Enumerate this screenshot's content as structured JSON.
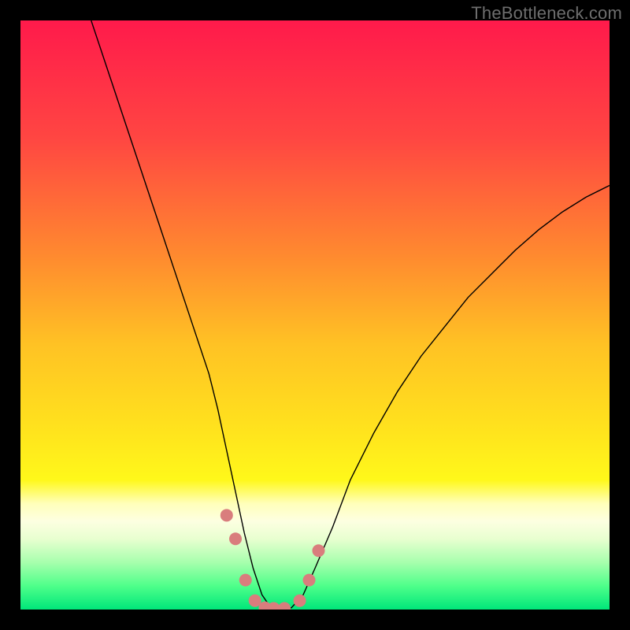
{
  "watermark": "TheBottleneck.com",
  "chart_data": {
    "type": "line",
    "title": "",
    "xlabel": "",
    "ylabel": "",
    "xlim": [
      0,
      100
    ],
    "ylim": [
      0,
      100
    ],
    "grid": false,
    "legend": false,
    "gradient_stops": [
      {
        "offset": 0.0,
        "color": "#ff1a4b"
      },
      {
        "offset": 0.2,
        "color": "#ff4642"
      },
      {
        "offset": 0.4,
        "color": "#ff8a2f"
      },
      {
        "offset": 0.55,
        "color": "#ffc224"
      },
      {
        "offset": 0.7,
        "color": "#ffe41d"
      },
      {
        "offset": 0.78,
        "color": "#fff81a"
      },
      {
        "offset": 0.82,
        "color": "#ffffba"
      },
      {
        "offset": 0.85,
        "color": "#fdffe1"
      },
      {
        "offset": 0.88,
        "color": "#e8ffd0"
      },
      {
        "offset": 0.92,
        "color": "#a7ffad"
      },
      {
        "offset": 0.96,
        "color": "#4eff8a"
      },
      {
        "offset": 1.0,
        "color": "#00e67a"
      }
    ],
    "series": [
      {
        "name": "bottleneck-curve",
        "color": "#000000",
        "width": 1.4,
        "x": [
          12,
          14,
          16,
          18,
          20,
          22,
          24,
          26,
          28,
          30,
          32,
          33.5,
          35,
          36.5,
          38,
          39.5,
          41,
          42.5,
          44,
          46,
          48,
          50,
          53,
          56,
          60,
          64,
          68,
          72,
          76,
          80,
          84,
          88,
          92,
          96,
          100
        ],
        "y": [
          100,
          94,
          88,
          82,
          76,
          70,
          64,
          58,
          52,
          46,
          40,
          34,
          27,
          20,
          13,
          7,
          2.5,
          0.3,
          0,
          0.3,
          2.5,
          7,
          14,
          22,
          30,
          37,
          43,
          48,
          53,
          57,
          61,
          64.5,
          67.5,
          70,
          72
        ]
      },
      {
        "name": "bottom-markers",
        "color": "#d97d7d",
        "type": "scatter",
        "radius": 8,
        "x": [
          35.0,
          36.5,
          38.2,
          39.8,
          41.5,
          43.0,
          44.8,
          47.4,
          49.0,
          50.6
        ],
        "y": [
          16.0,
          12.0,
          5.0,
          1.5,
          0.3,
          0.2,
          0.2,
          1.5,
          5.0,
          10.0
        ]
      }
    ]
  }
}
